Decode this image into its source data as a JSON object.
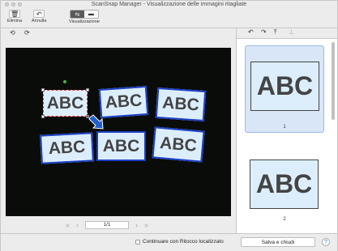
{
  "window": {
    "title": "ScanSnap Manager - Visualizzazione delle immagini ritagliate"
  },
  "toolbar": {
    "delete_label": "Elimina",
    "undo_label": "Annulla",
    "view_label": "Visualizzazione",
    "delete_icon": "trash-icon",
    "undo_icon": "undo-icon"
  },
  "canvas": {
    "card_text": "ABC",
    "cards_count_text": ""
  },
  "pager": {
    "page_value": "1/1"
  },
  "thumbnails": [
    {
      "text": "ABC",
      "number": "1"
    },
    {
      "text": "ABC",
      "number": "2"
    }
  ],
  "bottom": {
    "checkbox_label": "Continuare con Ritocco localizzato",
    "save_label": "Salva e chiudi",
    "help_label": "?"
  },
  "colors": {
    "card_fill": "#dceefb",
    "card_border": "#1b3fc6",
    "selection": "#e53935",
    "canvas_bg": "#0a0c0a"
  }
}
